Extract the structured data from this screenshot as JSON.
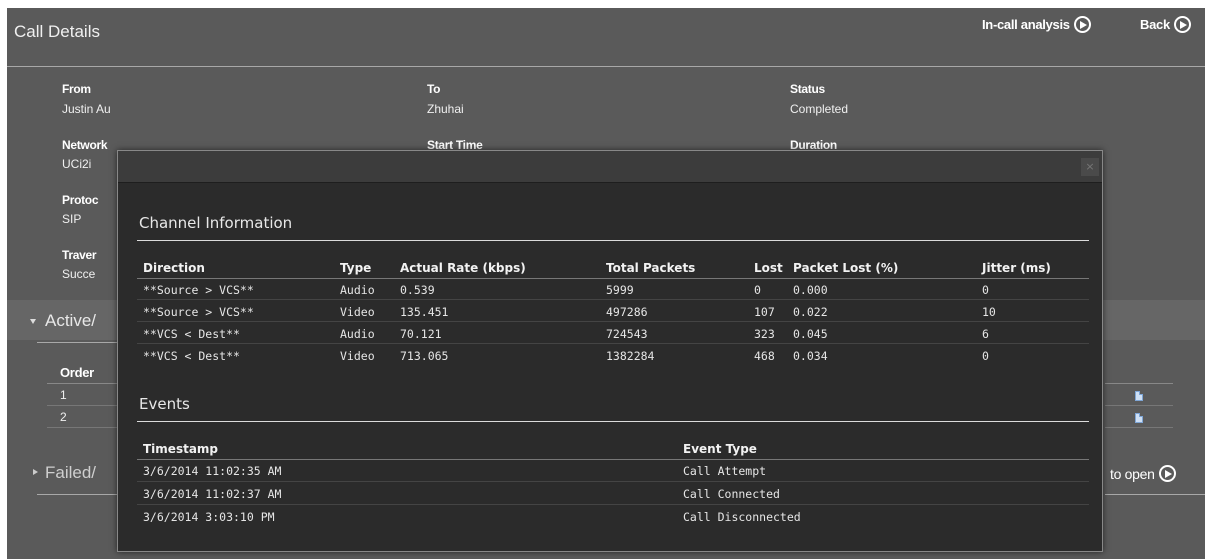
{
  "header": {
    "title": "Call Details",
    "in_call_analysis": "In-call analysis",
    "back": "Back"
  },
  "fields": {
    "from_label": "From",
    "from_value": "Justin Au",
    "to_label": "To",
    "to_value": "Zhuhai",
    "status_label": "Status",
    "status_value": "Completed",
    "network_label": "Network",
    "network_value": "UCi2i",
    "start_time_label": "Start Time",
    "duration_label": "Duration",
    "protocol_label": "Protoc",
    "protocol_value": "SIP",
    "traversal_label": "Traver",
    "traversal_value": "Succe"
  },
  "sections": {
    "active_title": "Active/",
    "failed_title": "Failed/",
    "order_header": "Order",
    "rows": [
      "1",
      "2"
    ],
    "open_link": "to open"
  },
  "modal": {
    "close_icon": "×",
    "channel_heading": "Channel Information",
    "channel_headers": [
      "Direction",
      "Type",
      "Actual Rate (kbps)",
      "Total Packets",
      "Lost",
      "Packet Lost (%)",
      "Jitter (ms)"
    ],
    "channel_rows": [
      [
        "**Source > VCS**",
        "Audio",
        "0.539",
        "5999",
        "0",
        "0.000",
        "0"
      ],
      [
        "**Source > VCS**",
        "Video",
        "135.451",
        "497286",
        "107",
        "0.022",
        "10"
      ],
      [
        "**VCS < Dest**",
        "Audio",
        "70.121",
        "724543",
        "323",
        "0.045",
        "6"
      ],
      [
        "**VCS < Dest**",
        "Video",
        "713.065",
        "1382284",
        "468",
        "0.034",
        "0"
      ]
    ],
    "events_heading": "Events",
    "events_headers": [
      "Timestamp",
      "Event Type"
    ],
    "events_rows": [
      [
        "3/6/2014 11:02:35 AM",
        "Call Attempt"
      ],
      [
        "3/6/2014 11:02:37 AM",
        "Call Connected"
      ],
      [
        "3/6/2014 3:03:10 PM",
        "Call Disconnected"
      ]
    ]
  }
}
